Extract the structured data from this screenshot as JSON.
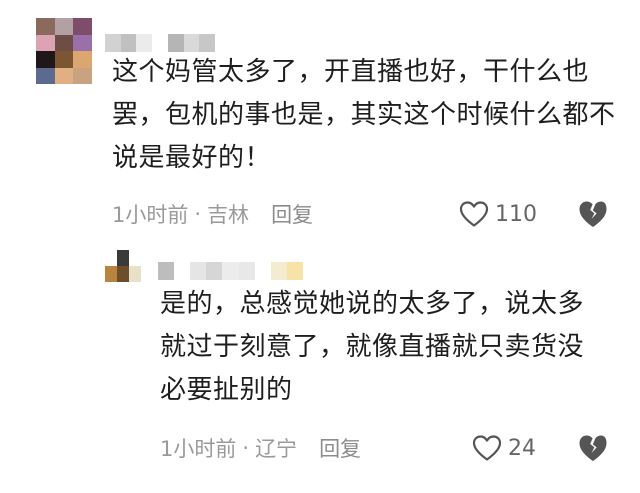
{
  "main_comment": {
    "avatar_colors": [
      "#8a6a5c",
      "#b2a1a3",
      "#7f4d6c",
      "#dca3b2",
      "#6e4d45",
      "#9b6fa7",
      "#1f171a",
      "#7c5632",
      "#d9a76f",
      "#5b6a8e",
      "#e2af82",
      "#c9a282"
    ],
    "name_colors": [
      "#d2d2d2",
      "#c0c0c0",
      "#ebebeb",
      "#ffffff",
      "#b5b5b5",
      "#d9d9d9",
      "#c7c7c7"
    ],
    "text": "这个妈管太多了，开直播也好，干什么也罢，包机的事也是，其实这个时候什么都不说是最好的！",
    "time": "1小时前",
    "separator": "·",
    "location": "吉林",
    "reply_label": "回复",
    "like_count": "110",
    "like_icon": "heart-outline-icon",
    "dislike_icon": "broken-heart-icon"
  },
  "reply_comment": {
    "avatar_colors": [
      "#ffffff",
      "#3a3a3a",
      "#ffffff",
      "#b88540",
      "#6e4d2a",
      "#e8e0c8"
    ],
    "name_colors": [
      "#bdbdbd",
      "#ffffff",
      "#e5e5e5",
      "#d6d6d6",
      "#ececec",
      "#e8e8e8",
      "#ffffff",
      "#f3ecd0",
      "#f7e3a6"
    ],
    "text": "是的，总感觉她说的太多了，说太多就过于刻意了，就像直播就只卖货没必要扯别的",
    "time": "1小时前",
    "separator": "·",
    "location": "辽宁",
    "reply_label": "回复",
    "like_count": "24",
    "like_icon": "heart-outline-icon",
    "dislike_icon": "broken-heart-icon"
  }
}
